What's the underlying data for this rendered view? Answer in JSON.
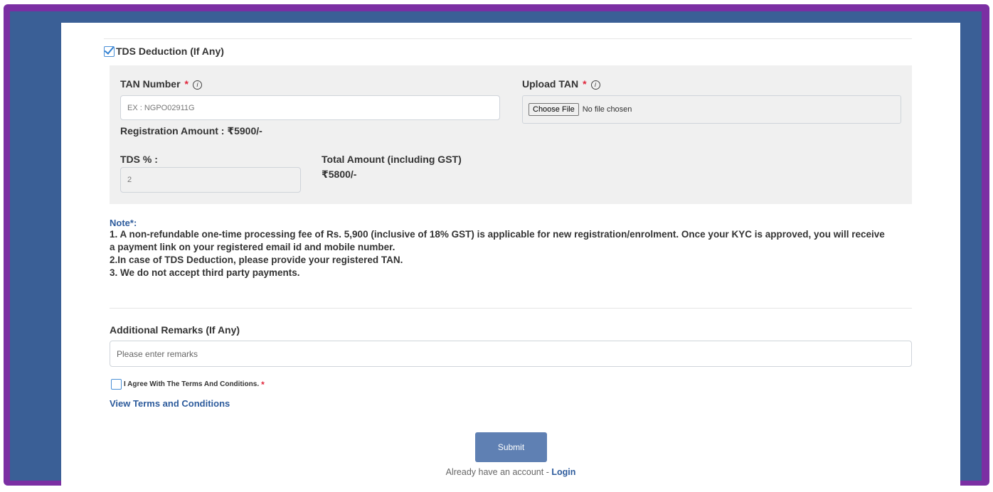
{
  "tds": {
    "label": "TDS Deduction (If Any)",
    "checked": true
  },
  "tan": {
    "label": "TAN Number",
    "required_mark": "*",
    "info_icon": "info-icon",
    "placeholder": "EX : NGPO02911G"
  },
  "upload_tan": {
    "label": "Upload TAN",
    "required_mark": "*",
    "choose_file_label": "Choose File",
    "no_file_text": "No file chosen"
  },
  "registration_amount": "Registration Amount : ₹5900/-",
  "tds_percent": {
    "label": "TDS % :",
    "value": "2"
  },
  "total_amount": {
    "label": "Total Amount (including GST)",
    "value": "₹5800/-"
  },
  "note": {
    "title": "Note*:",
    "lines": [
      "1. A non-refundable one-time processing fee of Rs. 5,900 (inclusive of 18% GST) is applicable for new registration/enrolment. Once your KYC is approved, you will receive a payment link on your registered email id and mobile number.",
      "2.In case of TDS Deduction, please provide your registered TAN.",
      "3. We do not accept third party payments."
    ]
  },
  "remarks": {
    "label": "Additional Remarks (If Any)",
    "placeholder": "Please enter remarks"
  },
  "agree": {
    "label": "I Agree With The Terms And Conditions.",
    "required_mark": "*"
  },
  "terms_link": "View Terms and Conditions",
  "submit_label": "Submit",
  "login": {
    "prefix": "Already have an account - ",
    "link": "Login"
  },
  "colors": {
    "frame": "#7b2fa3",
    "side_band": "#3a5f96",
    "accent": "#2d5b9c",
    "submit": "#5f80b3",
    "required": "#e0243a"
  }
}
